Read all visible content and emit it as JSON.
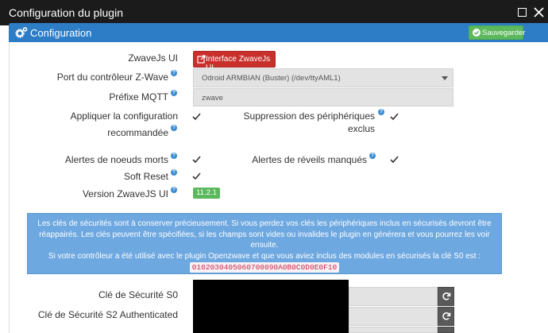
{
  "window": {
    "title": "Configuration du plugin"
  },
  "panel": {
    "title": "Configuration",
    "save_label": "Sauvegarder"
  },
  "fields": {
    "zwavejs_ui": {
      "label": "ZwaveJs UI",
      "button": "Interface ZwaveJs UI"
    },
    "port": {
      "label": "Port du contrôleur Z-Wave",
      "value": "Odroid ARMBIAN (Buster) (/dev/ttyAML1)"
    },
    "mqtt_prefix": {
      "label": "Préfixe MQTT",
      "value": "zwave"
    },
    "apply_config": {
      "label_line1": "Appliquer la configuration",
      "label_line2": "recommandée",
      "checked": true
    },
    "excluded_removal": {
      "label": "Suppression des périphériques exclus",
      "checked": true
    },
    "dead_nodes": {
      "label": "Alertes de noeuds morts",
      "checked": true
    },
    "missed_wakeups": {
      "label": "Alertes de réveils manqués",
      "checked": true
    },
    "soft_reset": {
      "label": "Soft Reset",
      "checked": true
    },
    "version": {
      "label": "Version ZwaveJS UI",
      "value": "11.2.1"
    }
  },
  "alert": {
    "line1": "Les clés de sécurités sont à conserver précieusement. Si vous perdez vos clés les périphériques inclus en sécurisés devront être réappairés. Les clés peuvent être spécifiées, si les champs sont vides ou invalides le plugin en générera et vous pourrez les voir ensuite.",
    "line2": "Si votre contrôleur a été utilisé avec le plugin Openzwave et que vous aviez inclus des modules en sécurisés la clé S0 est :",
    "code": "0102030405060708090A0B0C0D0E0F10"
  },
  "keys": {
    "s0_label": "Clé de Sécurité S0",
    "s2_auth_label": "Clé de Sécurité S2 Authenticated"
  },
  "colors": {
    "header": "#2d7cc6",
    "success": "#5cb85c",
    "danger": "#c9302c",
    "info": "#6ea8e0"
  }
}
